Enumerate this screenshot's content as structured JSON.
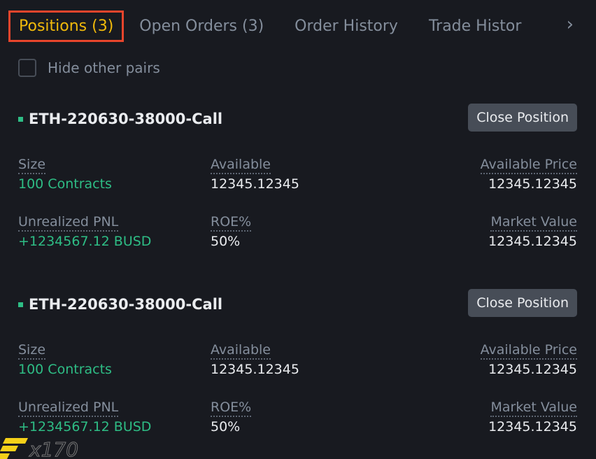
{
  "tabs": [
    "Positions (3)",
    "Open Orders (3)",
    "Order History",
    "Trade Histor"
  ],
  "hide_other_pairs": "Hide other pairs",
  "positions": [
    {
      "symbol": "ETH-220630-38000-Call",
      "close_label": "Close Position",
      "size_label": "Size",
      "size": "100 Contracts",
      "available_label": "Available",
      "available": "12345.12345",
      "avail_price_label": "Available Price",
      "avail_price": "12345.12345",
      "pnl_label": "Unrealized PNL",
      "pnl": "+1234567.12 BUSD",
      "roe_label": "ROE%",
      "roe": "50%",
      "mv_label": "Market Value",
      "mv": "12345.12345"
    },
    {
      "symbol": "ETH-220630-38000-Call",
      "close_label": "Close Position",
      "size_label": "Size",
      "size": "100 Contracts",
      "available_label": "Available",
      "available": "12345.12345",
      "avail_price_label": "Available Price",
      "avail_price": "12345.12345",
      "pnl_label": "Unrealized PNL",
      "pnl": "+1234567.12 BUSD",
      "roe_label": "ROE%",
      "roe": "50%",
      "mv_label": "Market Value",
      "mv": "12345.12345"
    }
  ],
  "colors": {
    "accent": "#f0b90b",
    "green": "#2ebd85",
    "highlight": "#e8452c"
  },
  "watermark": "Fx170"
}
